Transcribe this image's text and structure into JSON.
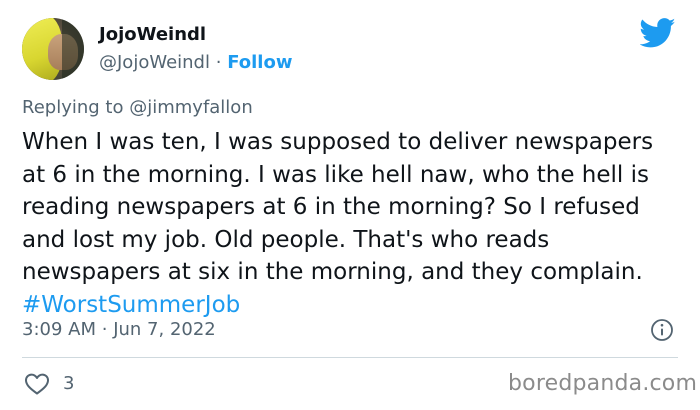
{
  "author": {
    "display_name": "JojoWeindl",
    "handle": "@JojoWeindl",
    "separator": "·",
    "follow_label": "Follow"
  },
  "reply": {
    "prefix": "Replying to",
    "to_handle": "@jimmyfallon"
  },
  "tweet": {
    "text": "When I was ten, I was supposed to deliver newspapers at 6 in the morning. I was like hell naw, who the hell is reading newspapers at 6 in the morning? So I refused and lost my job. Old people. That's who reads newspapers at six in the morning, and they complain.",
    "hashtag": "#WorstSummerJob",
    "time": "3:09 AM",
    "separator": "·",
    "date": "Jun 7, 2022"
  },
  "engagement": {
    "like_count": "3"
  },
  "watermark": {
    "text": "boredpanda.com"
  },
  "icons": {
    "brand": "twitter-bird-icon",
    "info": "info-icon",
    "like": "heart-icon"
  },
  "colors": {
    "accent": "#1d9bf0",
    "secondary_text": "#536471",
    "primary_text": "#0f1419",
    "divider": "#cfd9de"
  }
}
